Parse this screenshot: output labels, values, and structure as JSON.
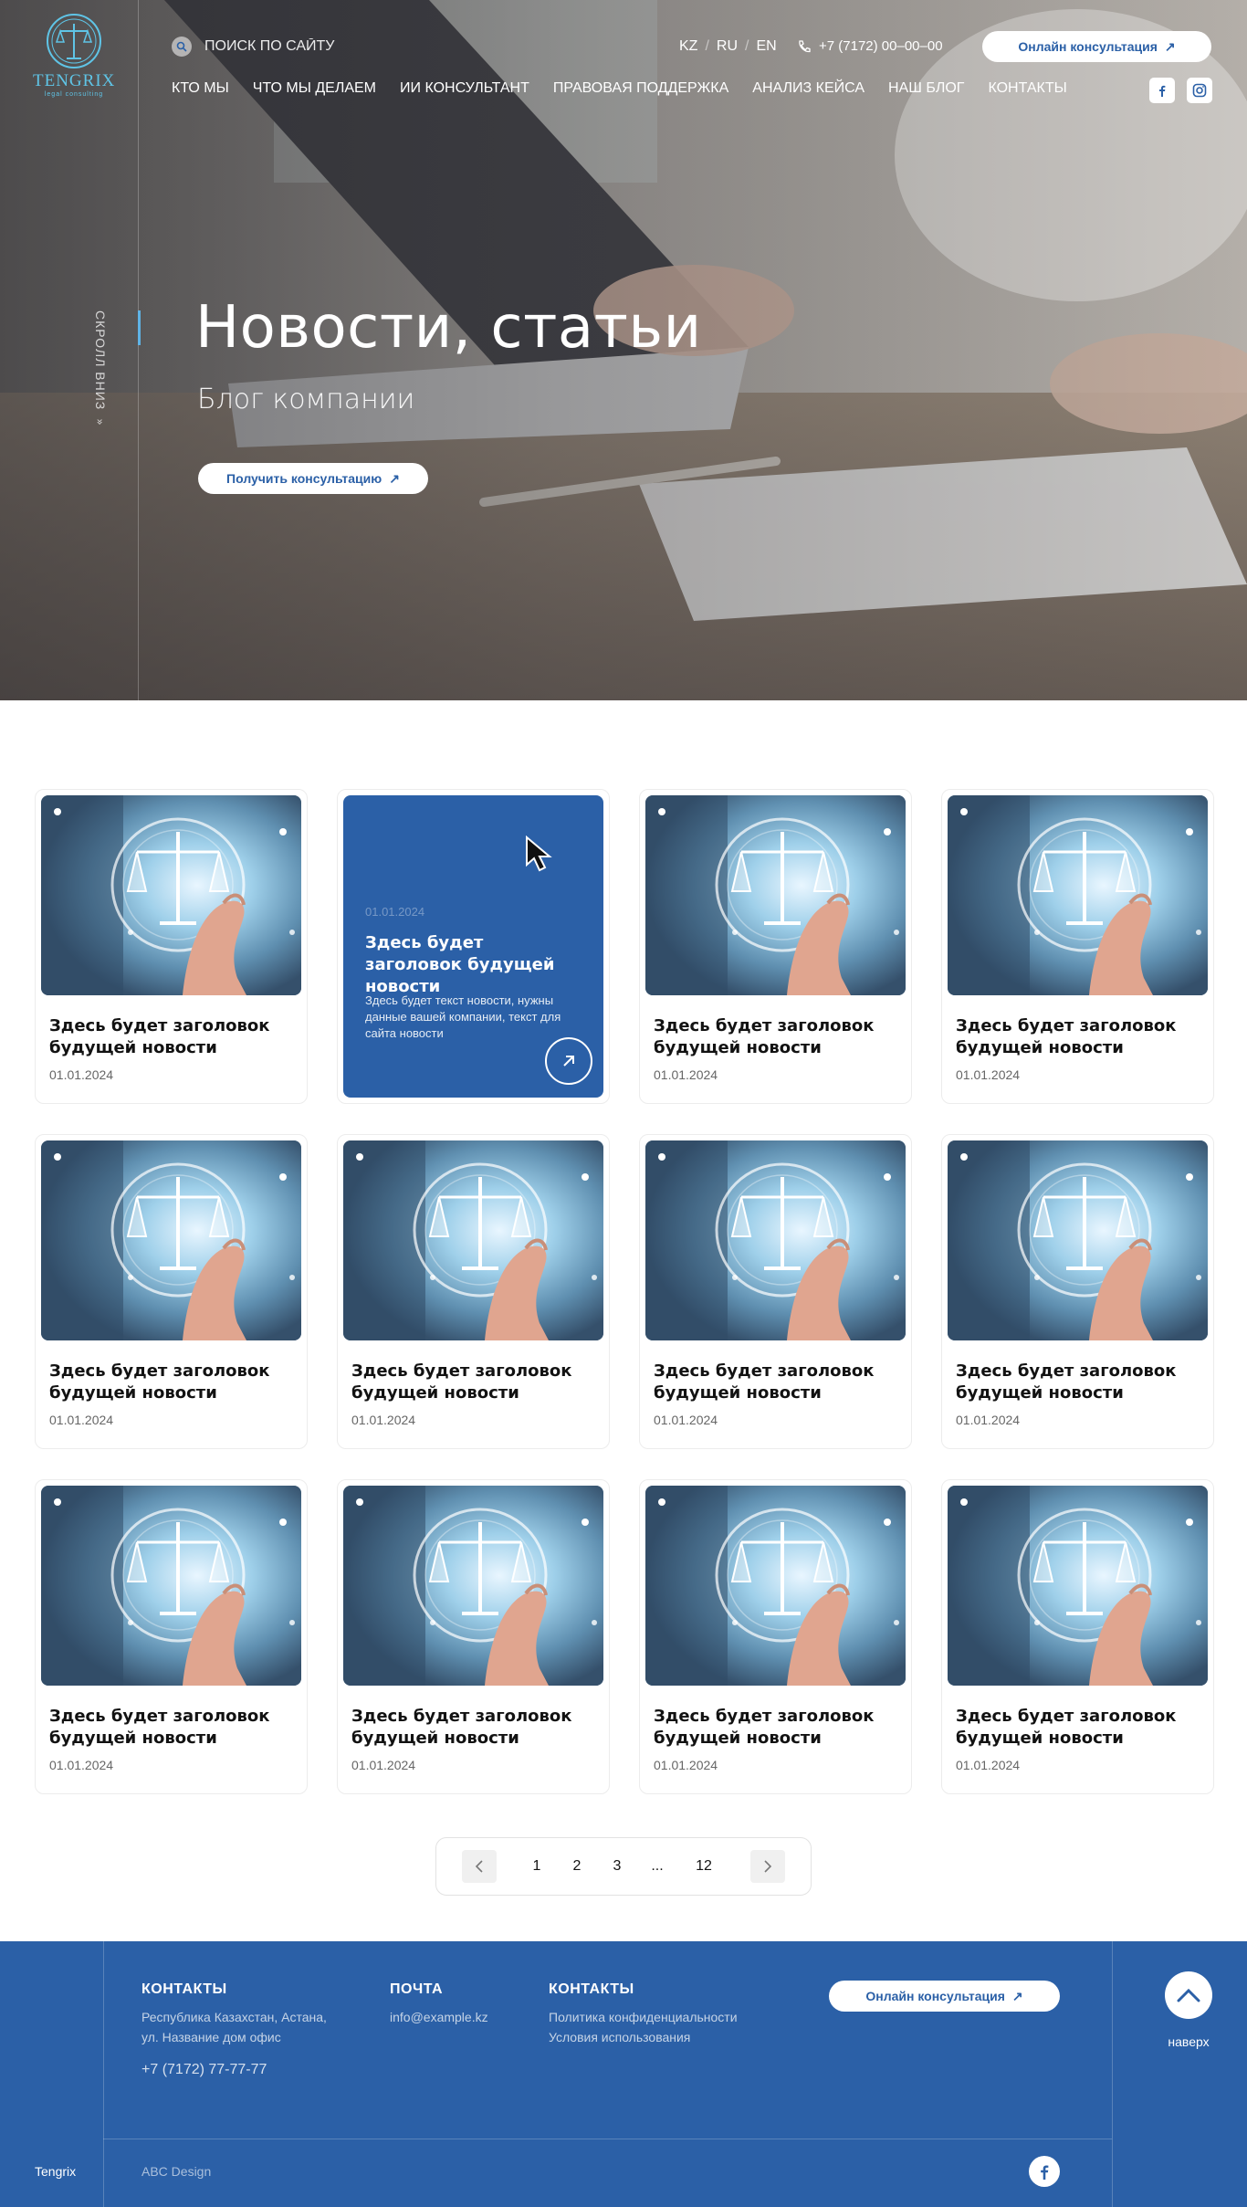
{
  "header": {
    "logo_name": "TENGRIX",
    "logo_sub": "legal consulting",
    "search_placeholder": "ПОИСК ПО САЙТУ",
    "languages": [
      "KZ",
      "RU",
      "EN"
    ],
    "phone": "+7 (7172) 00–00–00",
    "cta_label": "Онлайн консультация",
    "nav": [
      "КТО МЫ",
      "ЧТО МЫ ДЕЛАЕМ",
      "ИИ КОНСУЛЬТАНТ",
      "ПРАВОВАЯ ПОДДЕРЖКА",
      "АНАЛИЗ КЕЙСА",
      "НАШ БЛОГ",
      "КОНТАКТЫ"
    ]
  },
  "hero": {
    "scroll_label": "СКРОЛЛ ВНИЗ",
    "title": "Новости, статьи",
    "subtitle": "Блог компании",
    "cta_label": "Получить консультацию"
  },
  "cards": [
    {
      "title": "Здесь будет заголовок будущей новости",
      "date": "01.01.2024"
    },
    {
      "title": "Здесь будет заголовок будущей новости",
      "date": "01.01.2024",
      "active": true,
      "text": "Здесь будет текст новости, нужны данные вашей компании, текст для сайта новости"
    },
    {
      "title": "Здесь будет заголовок будущей новости",
      "date": "01.01.2024"
    },
    {
      "title": "Здесь будет заголовок будущей новости",
      "date": "01.01.2024"
    },
    {
      "title": "Здесь будет заголовок будущей новости",
      "date": "01.01.2024"
    },
    {
      "title": "Здесь будет заголовок будущей новости",
      "date": "01.01.2024"
    },
    {
      "title": "Здесь будет заголовок будущей новости",
      "date": "01.01.2024"
    },
    {
      "title": "Здесь будет заголовок будущей новости",
      "date": "01.01.2024"
    },
    {
      "title": "Здесь будет заголовок будущей новости",
      "date": "01.01.2024"
    },
    {
      "title": "Здесь будет заголовок будущей новости",
      "date": "01.01.2024"
    },
    {
      "title": "Здесь будет заголовок будущей новости",
      "date": "01.01.2024"
    },
    {
      "title": "Здесь будет заголовок будущей новости",
      "date": "01.01.2024"
    }
  ],
  "pagination": {
    "pages": [
      "1",
      "2",
      "3",
      "...",
      "12"
    ]
  },
  "footer": {
    "col1": {
      "heading": "КОНТАКТЫ",
      "address_line1": "Республика Казахстан, Астана,",
      "address_line2": "ул. Название дом офис",
      "phone": "+7 (7172) 77-77-77"
    },
    "col2": {
      "heading": "ПОЧТА",
      "email": "info@example.kz"
    },
    "col3": {
      "heading": "КОНТАКТЫ",
      "link1": "Политика конфиденциальности",
      "link2": "Условия использования"
    },
    "cta_label": "Онлайн консультация",
    "to_top_label": "наверх",
    "brand": "Tengrix",
    "designer": "ABC Design"
  },
  "colors": {
    "brand_blue": "#2b60a7",
    "accent_cyan": "#5fc4e6"
  }
}
